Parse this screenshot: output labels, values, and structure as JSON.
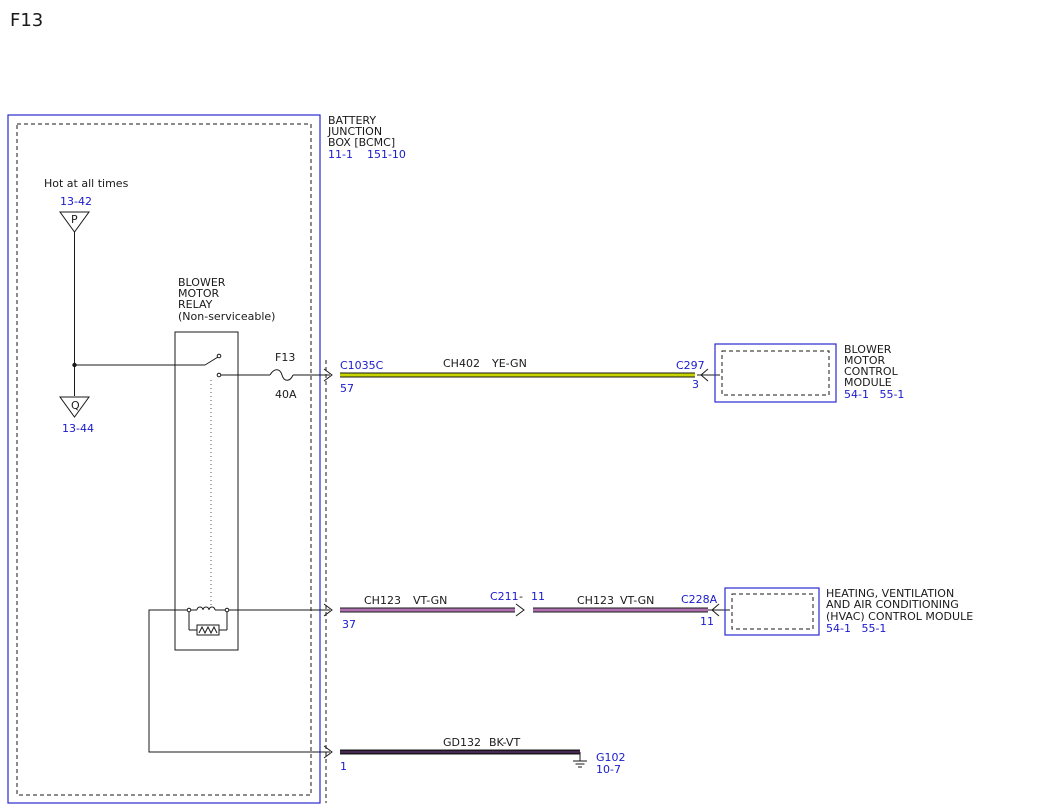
{
  "page_title": "F13",
  "junction_box": {
    "name_lines": [
      "BATTERY",
      "JUNCTION",
      "BOX [BCMC]"
    ],
    "refs": "11-1    151-10"
  },
  "hot_label": "Hot at all times",
  "terminal_p": {
    "ref": "13-42",
    "letter": "P"
  },
  "terminal_q": {
    "ref": "13-44",
    "letter": "Q"
  },
  "relay": {
    "name_lines": [
      "BLOWER",
      "MOTOR",
      "RELAY",
      "(Non-serviceable)"
    ]
  },
  "fuse": {
    "name": "F13",
    "rating": "40A"
  },
  "wire1": {
    "connector_left": "C1035C",
    "pin_left": "57",
    "circuit": "CH402",
    "color": "YE-GN",
    "connector_right": "C297",
    "pin_right": "3"
  },
  "blower_module": {
    "name_lines": [
      "BLOWER",
      "MOTOR",
      "CONTROL",
      "MODULE"
    ],
    "refs": "54-1   55-1"
  },
  "wire2": {
    "pin_left": "37",
    "circuit_a": "CH123",
    "color_a": "VT-GN",
    "connector_mid": "C211",
    "dash": "-",
    "pin_mid": "11",
    "circuit_b": "CH123",
    "color_b": "VT-GN",
    "connector_right": "C228A",
    "pin_right": "11"
  },
  "hvac_module": {
    "name_lines": [
      "HEATING, VENTILATION",
      "AND AIR CONDITIONING",
      "(HVAC) CONTROL MODULE"
    ],
    "refs": "54-1   55-1"
  },
  "wire3": {
    "pin_left": "1",
    "circuit": "GD132",
    "color": "BK-VT",
    "ground": "G102",
    "ground_ref": "10-7"
  },
  "colors": {
    "wire_yellow_green": "#c8d400",
    "wire_violet_green": "#b070b0",
    "wire_black": "#1a1a1a",
    "ref_blue": "#1a1acc",
    "box_blue": "#2a2ad0",
    "panel_fill": "#f2f2f2"
  }
}
